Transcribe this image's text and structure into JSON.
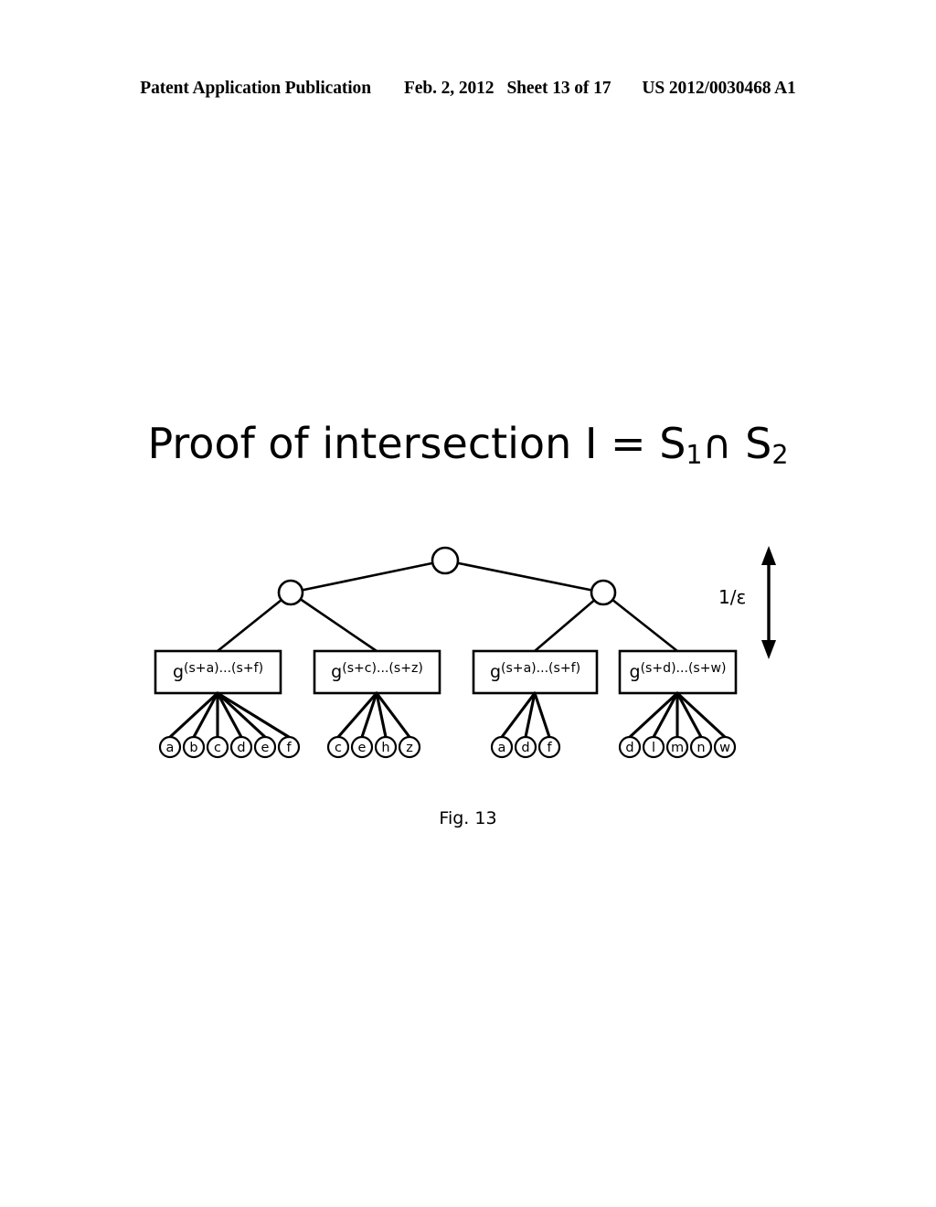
{
  "header": {
    "publication": "Patent Application Publication",
    "date": "Feb. 2, 2012",
    "sheet": "Sheet 13 of 17",
    "number": "US 2012/0030468 A1"
  },
  "figure": {
    "title_prefix": "Proof of intersection I = S",
    "title_sub1": "1",
    "title_intersection": "∩",
    "title_s2": " S",
    "title_sub2": "2",
    "title_full": "Proof of intersection I = S1∩ S2",
    "caption": "Fig. 13",
    "depth_annotation": "1/ε",
    "colors": {
      "stroke": "#000000",
      "fill": "#ffffff",
      "page": "#ffffff"
    },
    "tree": {
      "root": {
        "label": ""
      },
      "internal_nodes": [
        {
          "label": ""
        },
        {
          "label": ""
        }
      ],
      "groups": [
        {
          "box_base": "g",
          "box_exponent": "(s+a)...(s+f)",
          "leaves": [
            "a",
            "b",
            "c",
            "d",
            "e",
            "f"
          ]
        },
        {
          "box_base": "g",
          "box_exponent": "(s+c)...(s+z)",
          "leaves": [
            "c",
            "e",
            "h",
            "z"
          ]
        },
        {
          "box_base": "g",
          "box_exponent": "(s+a)...(s+f)",
          "leaves": [
            "a",
            "d",
            "f"
          ]
        },
        {
          "box_base": "g",
          "box_exponent": "(s+d)...(s+w)",
          "leaves": [
            "d",
            "l",
            "m",
            "n",
            "w"
          ]
        }
      ]
    }
  }
}
